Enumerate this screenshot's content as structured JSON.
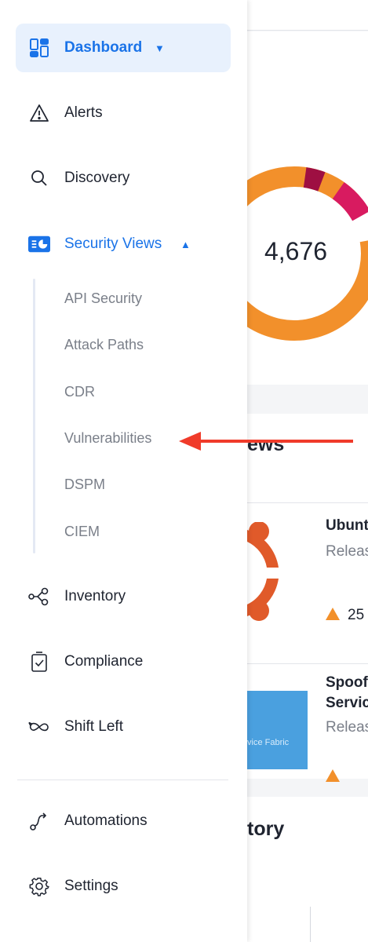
{
  "background": {
    "donut_total": "4,676",
    "news_title_suffix": "ews",
    "news_items": [
      {
        "title": "Ubunt",
        "sub": "Releas",
        "count": "25"
      },
      {
        "title": "Spoof",
        "title2": "Servic",
        "sub": "Releas",
        "image_text": "vice Fabric"
      }
    ],
    "inventory_title_suffix": "tory"
  },
  "sidebar": {
    "items": [
      {
        "label": "Dashboard"
      },
      {
        "label": "Alerts"
      },
      {
        "label": "Discovery"
      },
      {
        "label": "Security Views"
      },
      {
        "label": "Inventory"
      },
      {
        "label": "Compliance"
      },
      {
        "label": "Shift Left"
      },
      {
        "label": "Automations"
      },
      {
        "label": "Settings"
      }
    ],
    "security_views_sub": [
      {
        "label": "API Security"
      },
      {
        "label": "Attack Paths"
      },
      {
        "label": "CDR"
      },
      {
        "label": "Vulnerabilities"
      },
      {
        "label": "DSPM"
      },
      {
        "label": "CIEM"
      }
    ]
  },
  "colors": {
    "accent": "#1a73e8",
    "active_bg": "#e8f1fd",
    "annotation_arrow": "#f03b2a",
    "donut_orange": "#f2902b",
    "donut_pink": "#d81b60",
    "donut_maroon": "#9e0f42"
  },
  "icons": [
    "dashboard-icon",
    "alert-triangle-icon",
    "search-icon",
    "security-views-icon",
    "inventory-graph-icon",
    "clipboard-check-icon",
    "infinity-icon",
    "automation-icon",
    "gear-icon"
  ]
}
